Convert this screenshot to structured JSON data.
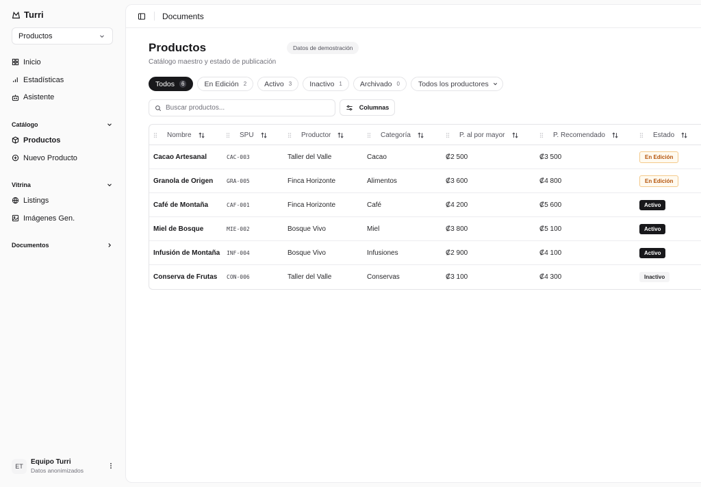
{
  "sidebar": {
    "brand": "Turri",
    "app_select": "Productos",
    "nav": [
      {
        "label": "Inicio",
        "icon": "grid-icon"
      },
      {
        "label": "Estadísticas",
        "icon": "bar-chart-icon"
      },
      {
        "label": "Asistente",
        "icon": "bot-icon"
      }
    ],
    "catalogo": {
      "title": "Catálogo",
      "items": [
        {
          "label": "Productos",
          "icon": "box-icon"
        },
        {
          "label": "Nuevo Producto",
          "icon": "plus-circle-icon"
        }
      ]
    },
    "vitrina": {
      "title": "Vitrina",
      "items": [
        {
          "label": "Listings",
          "icon": "globe-icon"
        },
        {
          "label": "Imágenes Gen.",
          "icon": "image-icon"
        }
      ]
    },
    "documentos": {
      "title": "Documentos"
    },
    "user": {
      "initials": "ET",
      "name": "Equipo Turri",
      "subtitle": "Datos anonimizados"
    }
  },
  "topbar": {
    "title": "Documents"
  },
  "page": {
    "title": "Productos",
    "demo_badge": "Datos de demostración",
    "subtitle": "Catálogo maestro y estado de publicación"
  },
  "filters": [
    {
      "label": "Todos",
      "count": "6"
    },
    {
      "label": "En Edición",
      "count": "2"
    },
    {
      "label": "Activo",
      "count": "3"
    },
    {
      "label": "Inactivo",
      "count": "1"
    },
    {
      "label": "Archivado",
      "count": "0"
    }
  ],
  "producer_filter": "Todos los productores",
  "search": {
    "placeholder": "Buscar productos..."
  },
  "columns_button": "Columnas",
  "table": {
    "headers": [
      "Nombre",
      "SPU",
      "Productor",
      "Categoría",
      "P. al por mayor",
      "P. Recomendado",
      "Estado"
    ],
    "rows": [
      {
        "name": "Cacao Artesanal",
        "spu": "CAC-003",
        "producer": "Taller del Valle",
        "category": "Cacao",
        "wholesale": "₡2 500",
        "recommended": "₡3 500",
        "status": "En Edición",
        "status_kind": "editing"
      },
      {
        "name": "Granola de Origen",
        "spu": "GRA-005",
        "producer": "Finca Horizonte",
        "category": "Alimentos",
        "wholesale": "₡3 600",
        "recommended": "₡4 800",
        "status": "En Edición",
        "status_kind": "editing"
      },
      {
        "name": "Café de Montaña",
        "spu": "CAF-001",
        "producer": "Finca Horizonte",
        "category": "Café",
        "wholesale": "₡4 200",
        "recommended": "₡5 600",
        "status": "Activo",
        "status_kind": "active"
      },
      {
        "name": "Miel de Bosque",
        "spu": "MIE-002",
        "producer": "Bosque Vivo",
        "category": "Miel",
        "wholesale": "₡3 800",
        "recommended": "₡5 100",
        "status": "Activo",
        "status_kind": "active"
      },
      {
        "name": "Infusión de Montaña",
        "spu": "INF-004",
        "producer": "Bosque Vivo",
        "category": "Infusiones",
        "wholesale": "₡2 900",
        "recommended": "₡4 100",
        "status": "Activo",
        "status_kind": "active"
      },
      {
        "name": "Conserva de Frutas",
        "spu": "CON-006",
        "producer": "Taller del Valle",
        "category": "Conservas",
        "wholesale": "₡3 100",
        "recommended": "₡4 300",
        "status": "Inactivo",
        "status_kind": "inactive"
      }
    ]
  }
}
